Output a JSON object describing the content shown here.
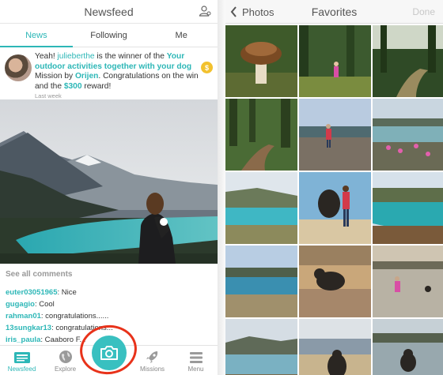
{
  "newsfeed": {
    "title": "Newsfeed",
    "tabs": [
      {
        "label": "News",
        "active": true
      },
      {
        "label": "Following",
        "active": false
      },
      {
        "label": "Me",
        "active": false
      }
    ],
    "notification": {
      "pre": "Yeah! ",
      "user": "julieberthe",
      "mid": " is the winner of the ",
      "challenge": "Your outdoor activities together with your dog",
      "mission_by": " Mission by ",
      "brand": "Orijen",
      "congrats": ". Congratulations on the win and the ",
      "reward": "$300",
      "reward_suffix": " reward!",
      "time": "Last week",
      "coin_symbol": "$"
    },
    "see_all_comments": "See all comments",
    "comments": [
      {
        "user": "euter03051965",
        "text": ": Nice"
      },
      {
        "user": "gugagio",
        "text": ": Cool"
      },
      {
        "user": "rahman01",
        "text": ": congratulations......"
      },
      {
        "user": "13sungkar13",
        "text": ": congratulations..."
      },
      {
        "user": "iris_paula",
        "text": ": Caaboro F..."
      }
    ],
    "bottom_nav": [
      {
        "label": "Newsfeed",
        "icon": "newsfeed-icon",
        "active": true
      },
      {
        "label": "Explore",
        "icon": "globe-icon",
        "active": false
      },
      {
        "label": "",
        "icon": "camera-icon",
        "active": false
      },
      {
        "label": "Missions",
        "icon": "rocket-icon",
        "active": false
      },
      {
        "label": "Menu",
        "icon": "menu-icon",
        "active": false
      }
    ]
  },
  "favorites": {
    "back_label": "Photos",
    "title": "Favorites",
    "done_label": "Done",
    "thumbnails": [
      "mushroom-in-forest",
      "child-in-forest",
      "forest-path",
      "woodland-path",
      "girl-on-rocks",
      "coast-with-flowers",
      "turquoise-bay",
      "dog-jumping-on-beach",
      "turquoise-lagoon",
      "lake-shore",
      "dog-on-sand",
      "child-in-shallow-water",
      "loch-view",
      "dog-on-beach",
      "dog-in-water"
    ]
  },
  "colors": {
    "accent": "#2db7b7",
    "highlight_circle": "#e8321a",
    "coin": "#f2c12e"
  }
}
